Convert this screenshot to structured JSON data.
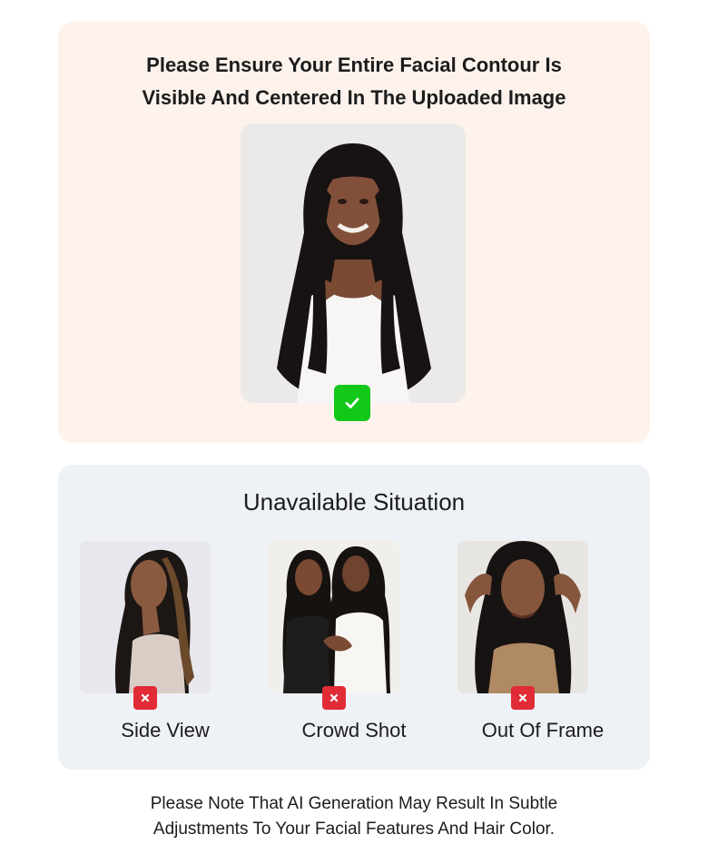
{
  "requirement": {
    "title": "Please Ensure Your Entire Facial Contour Is Visible And Centered In The Uploaded Image",
    "example_alt": "Front-facing centered portrait",
    "status_icon": "check-icon",
    "status_color": "#12c819"
  },
  "unavailable": {
    "title": "Unavailable Situation",
    "items": [
      {
        "label": "Side View",
        "status_icon": "close-icon"
      },
      {
        "label": "Crowd Shot",
        "status_icon": "close-icon"
      },
      {
        "label": "Out Of Frame",
        "status_icon": "close-icon"
      }
    ],
    "status_color": "#e12b36"
  },
  "note": "Please Note That AI Generation May Result In Subtle Adjustments To Your Facial Features And Hair Color."
}
